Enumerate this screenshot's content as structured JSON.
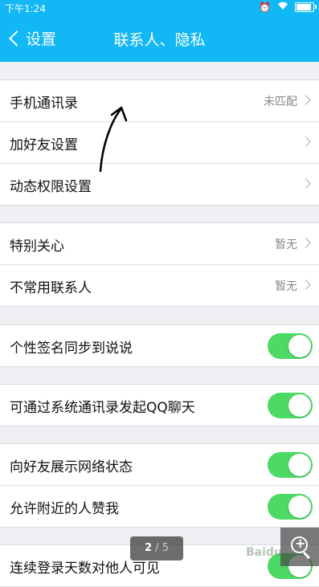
{
  "status_bar": {
    "time": "下午1:24"
  },
  "nav": {
    "back_label": "设置",
    "title": "联系人、隐私"
  },
  "groups": [
    {
      "rows": [
        {
          "label": "手机通讯录",
          "value": "未匹配",
          "control": "chevron"
        },
        {
          "label": "加好友设置",
          "value": "",
          "control": "chevron"
        },
        {
          "label": "动态权限设置",
          "value": "",
          "control": "chevron"
        }
      ]
    },
    {
      "rows": [
        {
          "label": "特别关心",
          "value": "暂无",
          "control": "chevron"
        },
        {
          "label": "不常用联系人",
          "value": "暂无",
          "control": "chevron"
        }
      ]
    },
    {
      "rows": [
        {
          "label": "个性签名同步到说说",
          "control": "toggle",
          "on": true
        }
      ]
    },
    {
      "rows": [
        {
          "label": "可通过系统通讯录发起QQ聊天",
          "control": "toggle",
          "on": true
        }
      ]
    },
    {
      "rows": [
        {
          "label": "向好友展示网络状态",
          "control": "toggle",
          "on": true
        },
        {
          "label": "允许附近的人赞我",
          "control": "toggle",
          "on": true
        }
      ]
    },
    {
      "rows": [
        {
          "label": "连续登录天数对他人可见",
          "control": "toggle",
          "on": true
        }
      ]
    }
  ],
  "pager": {
    "current": "2",
    "separator": " / ",
    "total": "5"
  },
  "watermark": "Baidu",
  "colors": {
    "accent": "#12b7f5",
    "toggle_on": "#4cd964"
  }
}
